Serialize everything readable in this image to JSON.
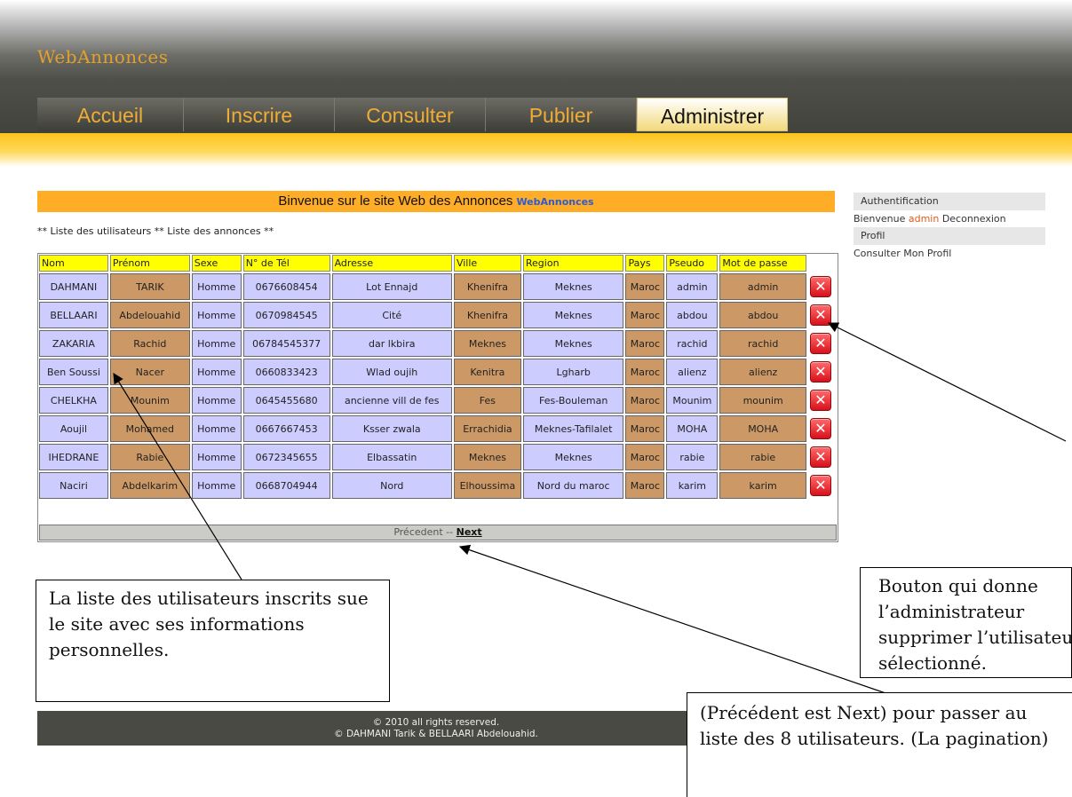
{
  "header": {
    "logo": "WebAnnonces"
  },
  "nav": {
    "tabs": [
      {
        "label": "Accueil"
      },
      {
        "label": "Inscrire"
      },
      {
        "label": "Consulter"
      },
      {
        "label": "Publier"
      },
      {
        "label": "Administrer",
        "active": true
      }
    ]
  },
  "main": {
    "welcome_text": "Binvenue sur le site Web des Annonces",
    "welcome_brand": "WebAnnonces",
    "links": {
      "sep": "**",
      "users": "Liste des utilisateurs",
      "ads": "Liste des annonces"
    },
    "columns": [
      "Nom",
      "Prénom",
      "Sexe",
      "N° de Tél",
      "Adresse",
      "Ville",
      "Region",
      "Pays",
      "Pseudo",
      "Mot de passe"
    ],
    "rows": [
      [
        "DAHMANI",
        "TARIK",
        "Homme",
        "0676608454",
        "Lot Ennajd",
        "Khenifra",
        "Meknes",
        "Maroc",
        "admin",
        "admin"
      ],
      [
        "BELLAARI",
        "Abdelouahid",
        "Homme",
        "0670984545",
        "Cité",
        "Khenifra",
        "Meknes",
        "Maroc",
        "abdou",
        "abdou"
      ],
      [
        "ZAKARIA",
        "Rachid",
        "Homme",
        "06784545377",
        "dar lkbira",
        "Meknes",
        "Meknes",
        "Maroc",
        "rachid",
        "rachid"
      ],
      [
        "Ben Soussi",
        "Nacer",
        "Homme",
        "0660833423",
        "Wlad oujih",
        "Kenitra",
        "Lgharb",
        "Maroc",
        "alienz",
        "alienz"
      ],
      [
        "CHELKHA",
        "Mounim",
        "Homme",
        "0645455680",
        "ancienne vill de fes",
        "Fes",
        "Fes-Bouleman",
        "Maroc",
        "Mounim",
        "mounim"
      ],
      [
        "Aoujil",
        "Mohamed",
        "Homme",
        "0667667453",
        "Ksser zwala",
        "Errachidia",
        "Meknes-Tafilalet",
        "Maroc",
        "MOHA",
        "MOHA"
      ],
      [
        "IHEDRANE",
        "Rabie",
        "Homme",
        "0672345655",
        "Elbassatin",
        "Meknes",
        "Meknes",
        "Maroc",
        "rabie",
        "rabie"
      ],
      [
        "Naciri",
        "Abdelkarim",
        "Homme",
        "0668704944",
        "Nord",
        "Elhoussima",
        "Nord du maroc",
        "Maroc",
        "karim",
        "karim"
      ]
    ],
    "delete_glyph": "✕",
    "pager": {
      "prev": "Précedent",
      "sep": "--",
      "next": "Next"
    }
  },
  "sidebar": {
    "auth_title": "Authentification",
    "welcome": "Bienvenue",
    "user": "admin",
    "logout": "Deconnexion",
    "profile_title": "Profil",
    "view_profile": "Consulter Mon Profil"
  },
  "footer": {
    "line1": "© 2010 all rights reserved.",
    "line2": "© DAHMANI Tarik & BELLAARI Abdelouahid."
  },
  "callouts": {
    "list": "La liste des utilisateurs inscrits sue le site avec ses informations personnelles.",
    "delete": "Bouton qui donne l’administrateur supprimer l’utilisateur sélectionné.",
    "pagination": "(Précédent est Next) pour passer au liste des 8 utilisateurs. (La pagination)"
  },
  "colors": {
    "accent": "#ffac27",
    "header_cell": "#ffff00",
    "cell_blue": "#ccccff",
    "cell_brown": "#cc9966"
  }
}
